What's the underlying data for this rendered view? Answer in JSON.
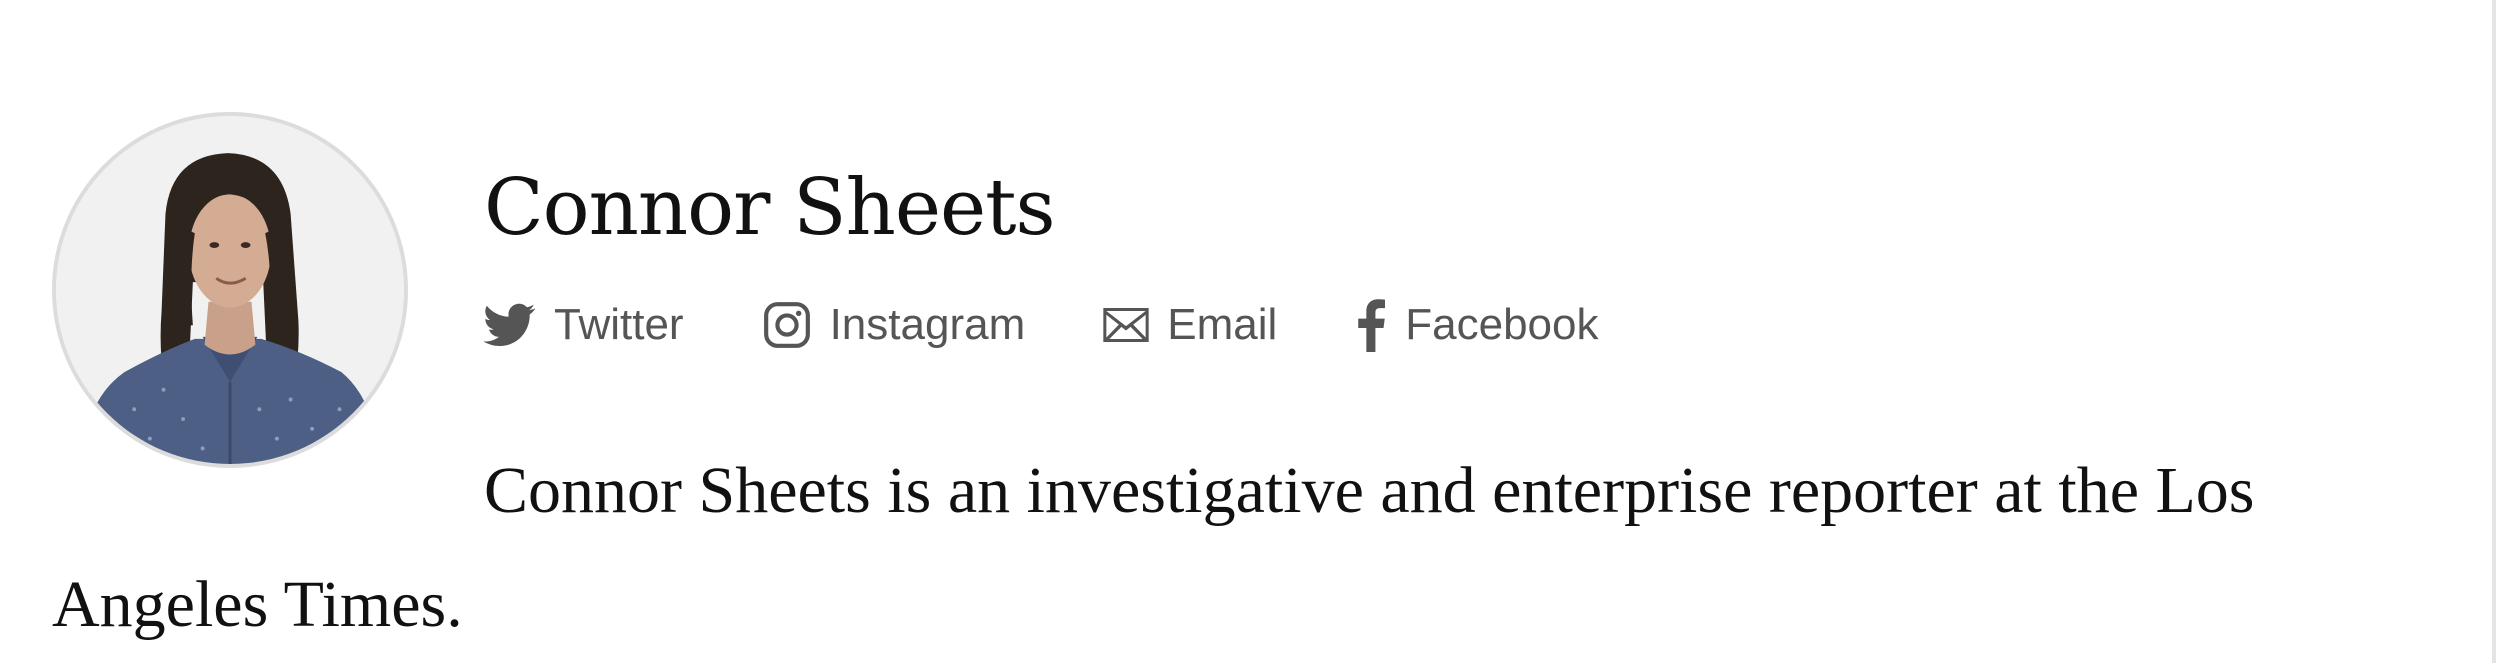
{
  "author": {
    "name": "Connor Sheets",
    "bio": "Connor Sheets is an investigative and enterprise reporter at the Los Angeles Times."
  },
  "social": {
    "links": [
      {
        "label": "Twitter",
        "icon": "twitter-icon"
      },
      {
        "label": "Instagram",
        "icon": "instagram-icon"
      },
      {
        "label": "Email",
        "icon": "email-icon"
      },
      {
        "label": "Facebook",
        "icon": "facebook-icon"
      }
    ]
  },
  "colors": {
    "text": "#111111",
    "link": "#555555",
    "avatar_border": "#dcdcdc",
    "avatar_bg": "#f1f1f1"
  }
}
